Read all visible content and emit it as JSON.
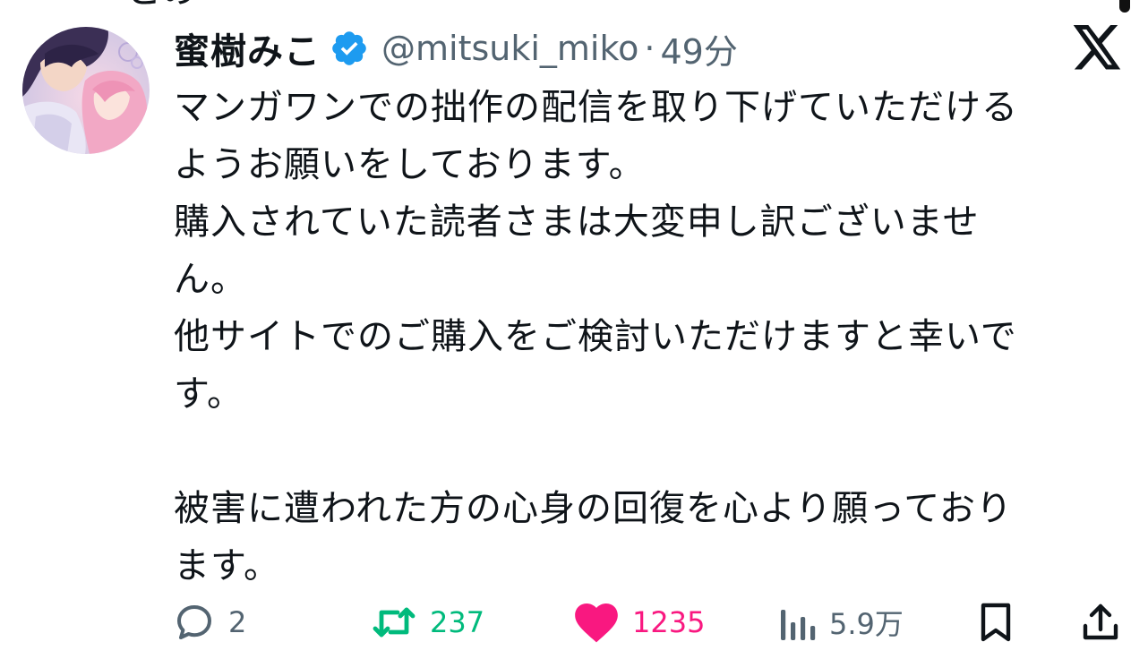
{
  "previous_line_clipped": "との",
  "post": {
    "author": {
      "display_name": "蜜樹みこ",
      "handle": "@mitsuki_miko",
      "verified": true
    },
    "separator": "·",
    "time": "49分",
    "body_lines": [
      "マンガワンでの拙作の配信を取り下げていただける",
      "ようお願いをしております。",
      "購入されていた読者さまは大変申し訳ございませ",
      "ん。",
      "他サイトでのご購入をご検討いただけますと幸いで",
      "す。",
      "",
      "被害に遭われた方の心身の回復を心より願っており",
      "ます。"
    ],
    "actions": {
      "reply_count": "2",
      "retweet_count": "237",
      "like_count": "1235",
      "view_count": "5.9万"
    }
  },
  "colors": {
    "text": "#0f1419",
    "secondary": "#536471",
    "verified": "#1d9bf0",
    "retweet": "#00ba7c",
    "like": "#f91880"
  },
  "icons": {
    "reply": "reply-icon",
    "retweet": "retweet-icon",
    "like": "heart-icon",
    "views": "views-icon",
    "bookmark": "bookmark-icon",
    "share": "share-icon",
    "platform": "x-logo-icon",
    "verified": "verified-badge-icon"
  }
}
